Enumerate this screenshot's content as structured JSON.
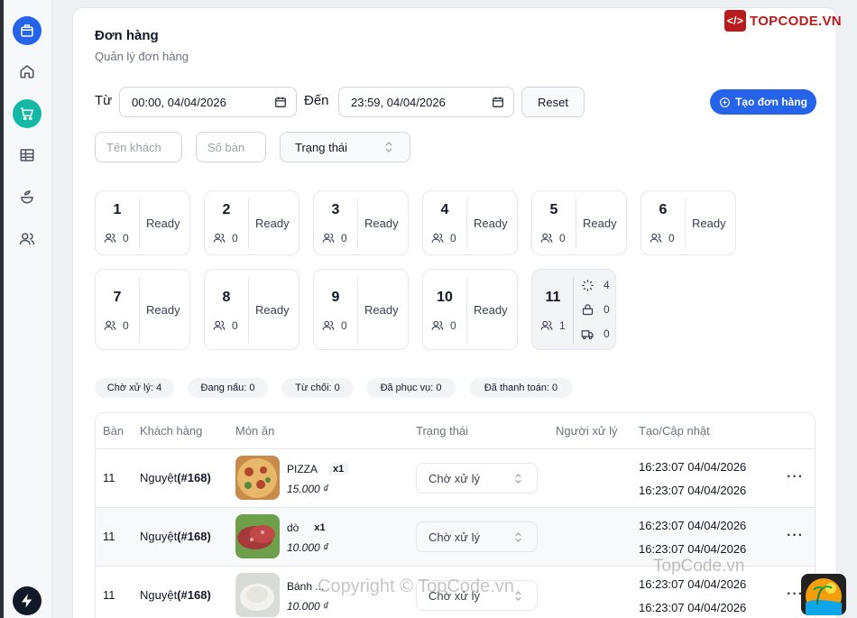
{
  "header": {
    "title": "Đơn hàng",
    "subtitle": "Quản lý đơn hàng"
  },
  "filters": {
    "from_label": "Từ",
    "from_value": "00:00, 04/04/2026",
    "to_label": "Đến",
    "to_value": "23:59, 04/04/2026",
    "reset_label": "Reset",
    "create_label": "Tạo đơn hàng",
    "customer_placeholder": "Tên khách",
    "table_placeholder": "Số bàn",
    "status_select": "Trạng thái"
  },
  "tables": [
    {
      "number": "1",
      "guests": "0",
      "status": "Ready"
    },
    {
      "number": "2",
      "guests": "0",
      "status": "Ready"
    },
    {
      "number": "3",
      "guests": "0",
      "status": "Ready"
    },
    {
      "number": "4",
      "guests": "0",
      "status": "Ready"
    },
    {
      "number": "5",
      "guests": "0",
      "status": "Ready"
    },
    {
      "number": "6",
      "guests": "0",
      "status": "Ready"
    },
    {
      "number": "7",
      "guests": "0",
      "status": "Ready"
    },
    {
      "number": "8",
      "guests": "0",
      "status": "Ready"
    },
    {
      "number": "9",
      "guests": "0",
      "status": "Ready"
    },
    {
      "number": "10",
      "guests": "0",
      "status": "Ready"
    }
  ],
  "active_table": {
    "number": "11",
    "guests": "1",
    "pending": "4",
    "cooking": "0",
    "delivering": "0"
  },
  "summary": [
    "Chờ xử lý: 4",
    "Đang nấu: 0",
    "Từ chối: 0",
    "Đã phục vụ: 0",
    "Đã thanh toán: 0"
  ],
  "orders": {
    "columns": [
      "Bàn",
      "Khách hàng",
      "Món ăn",
      "Trạng thái",
      "Người xử lý",
      "Tạo/Cập nhật"
    ],
    "rows": [
      {
        "table": "11",
        "customer": "Nguyệt",
        "customer_id": "(#168)",
        "dish": "PIZZA",
        "qty": "x1",
        "price": "15.000 ₫",
        "status": "Chờ xử lý",
        "handler": "",
        "created": "16:23:07 04/04/2026",
        "updated": "16:23:07 04/04/2026"
      },
      {
        "table": "11",
        "customer": "Nguyệt",
        "customer_id": "(#168)",
        "dish": "dò",
        "qty": "x1",
        "price": "10.000 ₫",
        "status": "Chờ xử lý",
        "handler": "",
        "created": "16:23:07 04/04/2026",
        "updated": "16:23:07 04/04/2026"
      },
      {
        "table": "11",
        "customer": "Nguyệt",
        "customer_id": "(#168)",
        "dish": "Bánh ...",
        "qty": "",
        "price": "10.000 ₫",
        "status": "Chờ xử lý",
        "handler": "",
        "created": "16:23:07 04/04/2026",
        "updated": "16:23:07 04/04/2026"
      }
    ]
  },
  "watermarks": {
    "logo": "TOPCODE.VN",
    "site": "TopCode.vn",
    "copyright": "Copyright © TopCode.vn"
  },
  "colors": {
    "primary": "#2563eb",
    "teal": "#14b8a6",
    "logo_red": "#b91c1c"
  }
}
